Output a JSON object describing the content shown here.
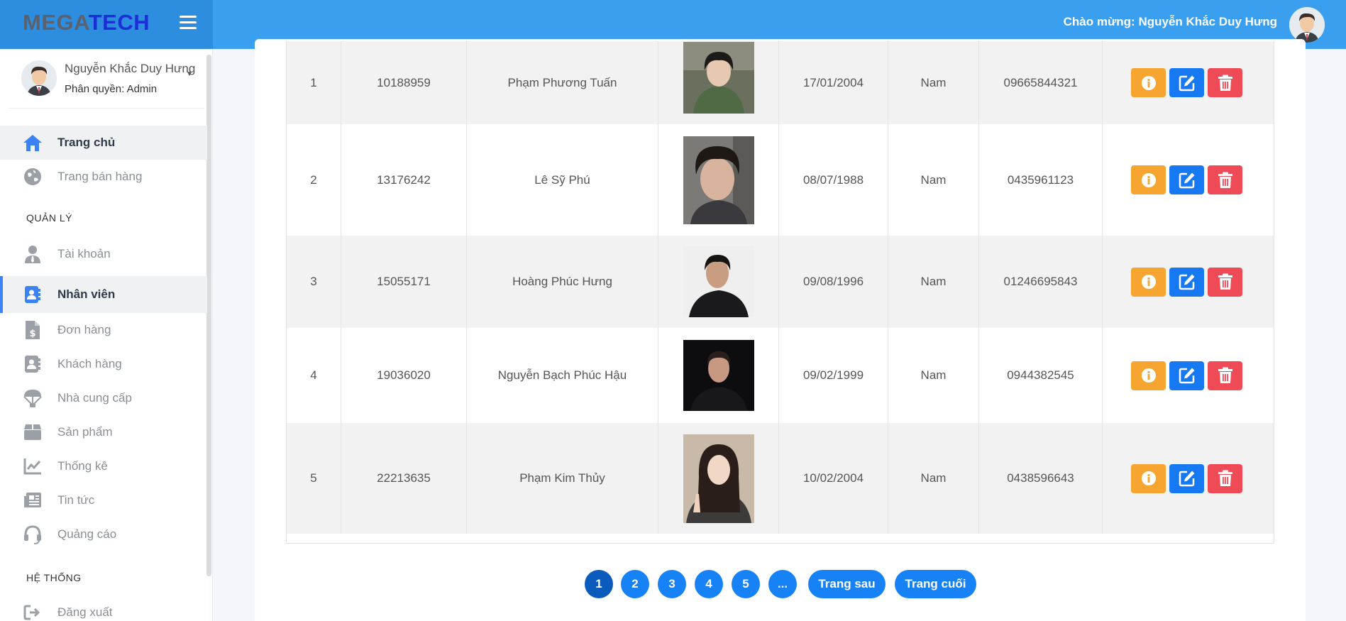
{
  "brand": {
    "part1": "MEGA",
    "part2": "TECH"
  },
  "header": {
    "welcome": "Chào mừng: Nguyễn Khắc Duy Hưng"
  },
  "user": {
    "name": "Nguyễn Khắc Duy Hưng",
    "role": "Phân quyền: Admin"
  },
  "nav": {
    "home": "Trang chủ",
    "store": "Trang bán hàng",
    "section_manage": "QUẢN LÝ",
    "accounts": "Tài khoản",
    "employees": "Nhân viên",
    "orders": "Đơn hàng",
    "customers": "Khách hàng",
    "suppliers": "Nhà cung cấp",
    "products": "Sản phẩm",
    "stats": "Thống kê",
    "news": "Tin tức",
    "ads": "Quảng cáo",
    "section_system": "HỆ THỐNG",
    "logout": "Đăng xuất"
  },
  "colors": {
    "topbar": "#3b9ff0",
    "info": "#f7a531",
    "edit": "#1779f2",
    "delete": "#ee4b57",
    "pager": "#1682f5"
  },
  "rows": [
    {
      "stt": "1",
      "code": "10188959",
      "name": "Phạm Phương Tuấn",
      "dob": "17/01/2004",
      "gender": "Nam",
      "phone": "09665844321"
    },
    {
      "stt": "2",
      "code": "13176242",
      "name": "Lê Sỹ Phú",
      "dob": "08/07/1988",
      "gender": "Nam",
      "phone": "0435961123"
    },
    {
      "stt": "3",
      "code": "15055171",
      "name": "Hoàng Phúc Hưng",
      "dob": "09/08/1996",
      "gender": "Nam",
      "phone": "01246695843"
    },
    {
      "stt": "4",
      "code": "19036020",
      "name": "Nguyễn Bạch Phúc Hậu",
      "dob": "09/02/1999",
      "gender": "Nam",
      "phone": "0944382545"
    },
    {
      "stt": "5",
      "code": "22213635",
      "name": "Phạm Kim Thủy",
      "dob": "10/02/2004",
      "gender": "Nam",
      "phone": "0438596643"
    }
  ],
  "pagination": {
    "p1": "1",
    "p2": "2",
    "p3": "3",
    "p4": "4",
    "p5": "5",
    "more": "...",
    "next": "Trang sau",
    "last": "Trang cuối"
  }
}
